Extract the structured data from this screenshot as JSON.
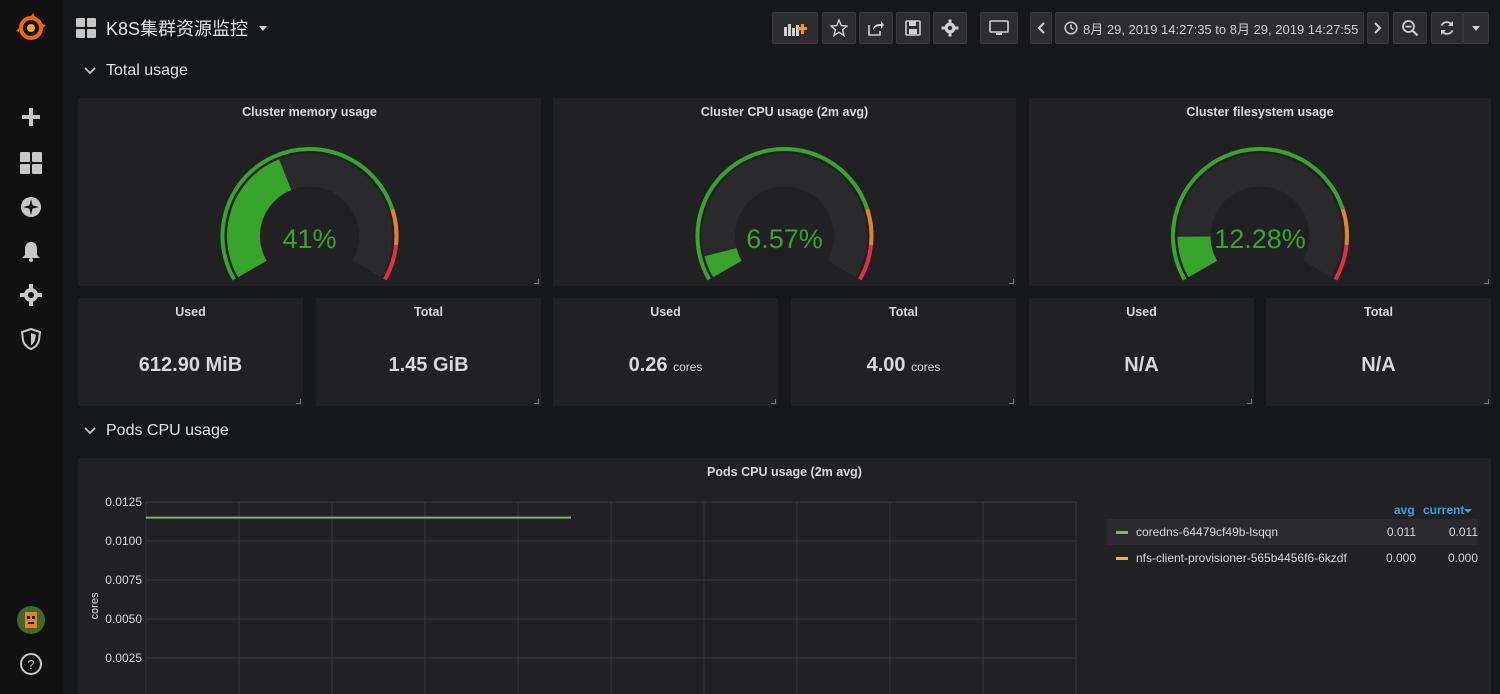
{
  "navbar": {
    "dashboard_title": "K8S集群资源监控",
    "time_range": "8月 29, 2019 14:27:35 to 8月 29, 2019 14:27:55"
  },
  "rows": {
    "total_usage": "Total usage",
    "pods_cpu": "Pods CPU usage"
  },
  "gauges": [
    {
      "title": "Cluster memory usage",
      "value_text": "41%",
      "percent": 41
    },
    {
      "title": "Cluster CPU usage (2m avg)",
      "value_text": "6.57%",
      "percent": 6.57
    },
    {
      "title": "Cluster filesystem usage",
      "value_text": "12.28%",
      "percent": 12.28
    }
  ],
  "stats": [
    {
      "title": "Used",
      "value": "612.90 MiB",
      "unit": ""
    },
    {
      "title": "Total",
      "value": "1.45 GiB",
      "unit": ""
    },
    {
      "title": "Used",
      "value": "0.26",
      "unit": "cores"
    },
    {
      "title": "Total",
      "value": "4.00",
      "unit": "cores"
    },
    {
      "title": "Used",
      "value": "N/A",
      "unit": ""
    },
    {
      "title": "Total",
      "value": "N/A",
      "unit": ""
    }
  ],
  "colors": {
    "green": "#37a42c",
    "orange": "#e5812c",
    "red": "#e02f44",
    "gauge_track": "#2a2a2d",
    "series_coredns": "#7eb26d",
    "series_nfs": "#eab839"
  },
  "legend": {
    "col_avg": "avg",
    "col_current": "current",
    "rows": [
      {
        "name": "coredns-64479cf49b-lsqqn",
        "avg": "0.011",
        "current": "0.011"
      },
      {
        "name": "nfs-client-provisioner-565b4456f6-6kzdf",
        "avg": "0.000",
        "current": "0.000"
      }
    ]
  },
  "chart_data": {
    "type": "line",
    "title": "Pods CPU usage (2m avg)",
    "ylabel": "cores",
    "yticks": [
      "0.0125",
      "0.0100",
      "0.0075",
      "0.0050",
      "0.0025"
    ],
    "ylim": [
      0,
      0.0125
    ],
    "grid": true,
    "series": [
      {
        "name": "coredns-64479cf49b-lsqqn",
        "values": [
          0.0115,
          0.0115
        ]
      },
      {
        "name": "nfs-client-provisioner-565b4456f6-6kzdf",
        "values": [
          0,
          0
        ]
      }
    ]
  }
}
